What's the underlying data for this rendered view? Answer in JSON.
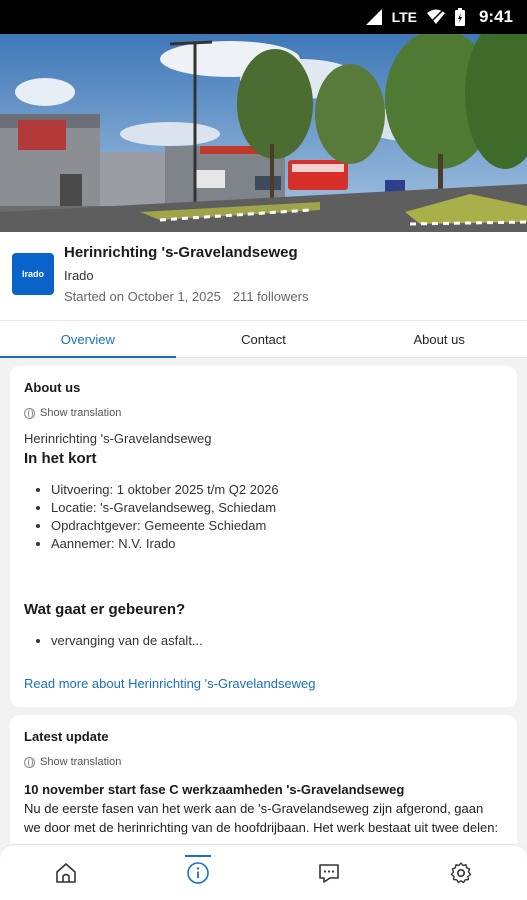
{
  "status_bar": {
    "network": "LTE",
    "time": "9:41"
  },
  "project": {
    "logo_text": "Irado",
    "title": "Herinrichting 's-Gravelandseweg",
    "organization": "Irado",
    "started": "Started on October 1, 2025",
    "followers": "211 followers"
  },
  "tabs": [
    {
      "label": "Overview",
      "active": true
    },
    {
      "label": "Contact",
      "active": false
    },
    {
      "label": "About us",
      "active": false
    }
  ],
  "about": {
    "title": "About us",
    "show_translation": "Show translation",
    "subtitle": "Herinrichting 's-Gravelandseweg",
    "heading": "In het kort",
    "bullets": [
      "Uitvoering: 1 oktober 2025 t/m Q2 2026",
      "Locatie: 's-Gravelandseweg, Schiedam",
      "Opdrachtgever: Gemeente Schiedam",
      "Aannemer: N.V. Irado"
    ],
    "section_heading": "Wat gaat er gebeuren?",
    "section_bullets": [
      "vervanging van de asfalt..."
    ],
    "read_more": "Read more about Herinrichting 's-Gravelandseweg"
  },
  "latest_update": {
    "title": "Latest update",
    "show_translation": "Show translation",
    "headline": "10 november start fase C werkzaamheden 's-Gravelandseweg",
    "body": "Nu de eerste fasen van het werk aan de 's-Gravelandseweg zijn afgerond, gaan we door met de herinrichting van de hoofdrijbaan. Het werk bestaat uit twee delen:"
  },
  "bottom_nav": [
    {
      "icon": "home-icon",
      "active": false
    },
    {
      "icon": "info-icon",
      "active": true
    },
    {
      "icon": "chat-icon",
      "active": false
    },
    {
      "icon": "gear-icon",
      "active": false
    }
  ],
  "colors": {
    "accent": "#1a6fc4",
    "logo_bg": "#0a63c9"
  }
}
